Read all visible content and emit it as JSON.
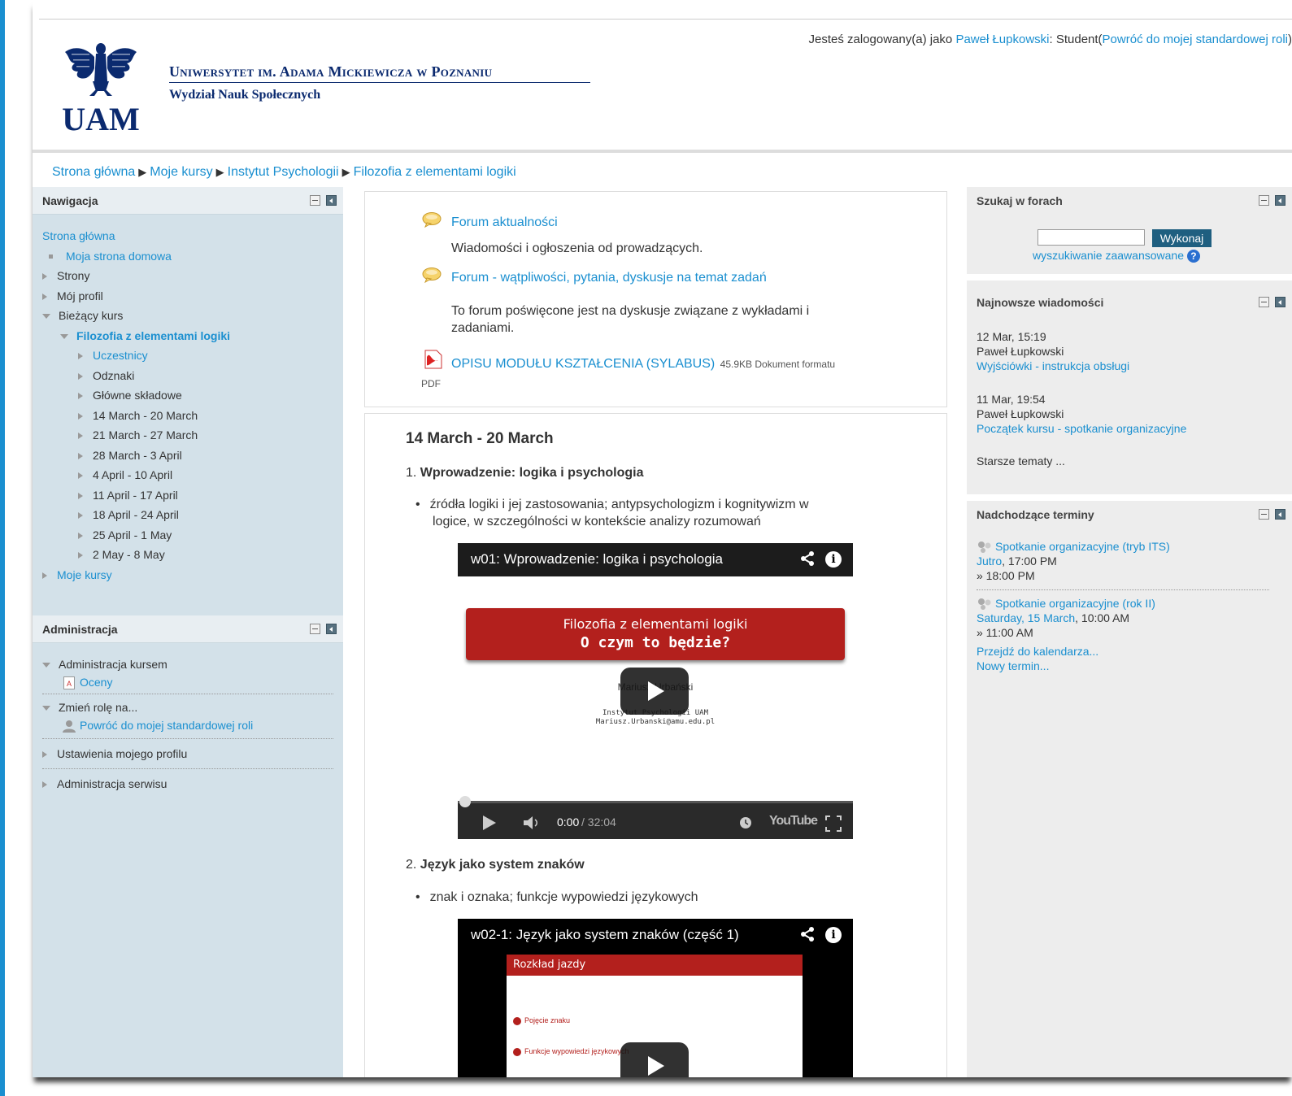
{
  "header": {
    "login_prefix": "Jesteś zalogowany(a) jako ",
    "login_user": "Paweł Łupkowski",
    "login_role": ": Student(",
    "login_return": "Powróć do mojej standardowej roli",
    "login_suffix": ")",
    "university": "Uniwersytet im. Adama Mickiewicza w Poznaniu",
    "faculty": "Wydział Nauk Społecznych"
  },
  "breadcrumb": [
    "Strona główna",
    "Moje kursy",
    "Instytut Psychologii",
    "Filozofia z elementami logiki"
  ],
  "navigation": {
    "title": "Nawigacja",
    "home": "Strona główna",
    "items": [
      "Moja strona domowa",
      "Strony",
      "Mój profil",
      "Bieżący kurs"
    ],
    "course": "Filozofia z elementami logiki",
    "course_items": [
      "Uczestnicy",
      "Odznaki",
      "Główne składowe",
      "14 March - 20 March",
      "21 March - 27 March",
      "28 March - 3 April",
      "4 April - 10 April",
      "11 April - 17 April",
      "18 April - 24 April",
      "25 April - 1 May",
      "2 May - 8 May"
    ],
    "my_courses": "Moje kursy"
  },
  "administration": {
    "title": "Administracja",
    "course_admin": "Administracja kursem",
    "grades": "Oceny",
    "switch_role": "Zmień rolę na...",
    "return_role": "Powróć do mojej standardowej roli",
    "profile_settings": "Ustawienia mojego profilu",
    "site_admin": "Administracja serwisu"
  },
  "section0": {
    "forum1_title": "Forum aktualności",
    "forum1_desc": "Wiadomości i ogłoszenia od prowadzących.",
    "forum2_title": "Forum - wątpliwości, pytania, dyskusje na temat zadań",
    "forum2_desc_1": "To forum poświęcone jest na dyskusje związane z wykładami i",
    "forum2_desc_2": "zadaniami.",
    "file_title": "OPISU MODUŁU KSZTAŁCENIA (SYLABUS)",
    "file_meta": "45.9KB Dokument formatu",
    "file_type": "PDF"
  },
  "section1": {
    "title": "14 March - 20 March",
    "topic1_num": "1. ",
    "topic1": "Wprowadzenie: logika i psychologia",
    "topic1_desc_1": "źródła logiki i jej zastosowania; antypsychologizm i kognitywizm w",
    "topic1_desc_2": "logice, w szczególności w kontekście analizy rozumowań",
    "video1_title": "w01: Wprowadzenie: logika i psychologia",
    "video1_banner_1": "Filozofia z elementami logiki",
    "video1_banner_2": "O czym to będzie?",
    "video1_author": "Mariusz Urbański",
    "video1_inst": "Instytut Psychologii UAM",
    "video1_email": "Mariusz.Urbanski@amu.edu.pl",
    "video1_time": "0:00",
    "video1_duration": " / 32:04",
    "video1_brand": "YouTube",
    "topic2_num": "2. ",
    "topic2": "Język jako system znaków",
    "topic2_desc": "znak i oznaka; funkcje wypowiedzi językowych",
    "video2_title": "w02-1: Język jako system znaków (część 1)",
    "video2_slide_head": "Rozkład jazdy",
    "video2_item1": "Pojęcie znaku",
    "video2_item2": "Funkcje wypowiedzi językowych"
  },
  "search_forums": {
    "title": "Szukaj w forach",
    "button": "Wykonaj",
    "advanced": "wyszukiwanie zaawansowane"
  },
  "latest_news": {
    "title": "Najnowsze wiadomości",
    "items": [
      {
        "date": "12 Mar, 15:19",
        "author": "Paweł Łupkowski",
        "subject": "Wyjściówki - instrukcja obsługi"
      },
      {
        "date": "11 Mar, 19:54",
        "author": "Paweł Łupkowski",
        "subject": "Początek kursu - spotkanie organizacyjne"
      }
    ],
    "older": "Starsze tematy ..."
  },
  "upcoming": {
    "title": "Nadchodzące terminy",
    "events": [
      {
        "name": "Spotkanie organizacyjne (tryb ITS)",
        "day": "Jutro",
        "time": ", 17:00 PM",
        "end": "» 18:00 PM"
      },
      {
        "name": "Spotkanie organizacyjne (rok II)",
        "day": "Saturday, 15 March",
        "time": ", 10:00 AM",
        "end": "» 11:00 AM"
      }
    ],
    "calendar": "Przejdź do kalendarza...",
    "new_event": "Nowy termin..."
  },
  "colors": {
    "link": "#1a8fd0",
    "nav_bg": "#d3e1e9",
    "right_bg": "#ededed",
    "button": "#1f5f80",
    "banner": "#b3201d"
  }
}
